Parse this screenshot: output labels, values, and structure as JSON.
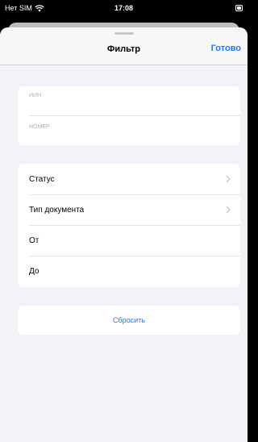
{
  "status_bar": {
    "carrier": "Нет SIM",
    "time": "17:08"
  },
  "nav": {
    "title": "Фильтр",
    "done_label": "Готово"
  },
  "inputs": [
    {
      "placeholder": "ИИН",
      "value": ""
    },
    {
      "placeholder": "НОМЕР",
      "value": ""
    }
  ],
  "list": [
    {
      "label": "Статус",
      "has_chevron": true
    },
    {
      "label": "Тип документа",
      "has_chevron": true
    },
    {
      "label": "От",
      "has_chevron": false
    },
    {
      "label": "До",
      "has_chevron": false
    }
  ],
  "reset_label": "Сбросить",
  "colors": {
    "accent": "#1a7cf0",
    "background": "#f2f2f7",
    "card": "#ffffff"
  },
  "icons": [
    "wifi-icon",
    "battery-icon",
    "chevron-right-icon"
  ]
}
